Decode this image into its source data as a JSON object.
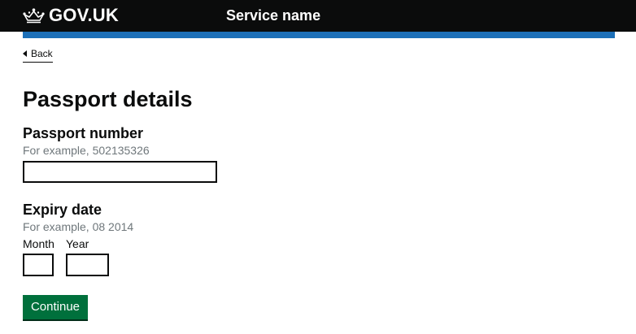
{
  "header": {
    "logo_text": "GOV.UK",
    "service_name": "Service name"
  },
  "nav": {
    "back_label": "Back"
  },
  "page": {
    "title": "Passport details"
  },
  "form": {
    "passport_number": {
      "label": "Passport number",
      "hint": "For example, 502135326",
      "value": ""
    },
    "expiry_date": {
      "label": "Expiry date",
      "hint": "For example, 08 2014",
      "month_label": "Month",
      "month_value": "",
      "year_label": "Year",
      "year_value": ""
    },
    "submit_label": "Continue"
  },
  "colors": {
    "header_bg": "#0b0c0c",
    "accent_bar": "#1d70b8",
    "button_bg": "#00703c",
    "hint_text": "#6f777b"
  },
  "icons": {
    "logo": "crown-icon",
    "back": "triangle-left-icon"
  }
}
